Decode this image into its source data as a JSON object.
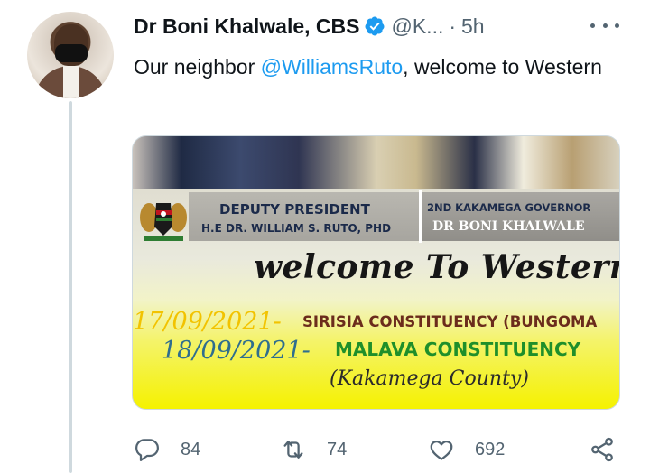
{
  "author": {
    "name": "Dr Boni Khalwale, CBS",
    "handle": "@K...",
    "separator": "·",
    "time": "5h"
  },
  "tweet": {
    "text_before": "Our neighbor ",
    "mention": "@WilliamsRuto",
    "text_after": ", welcome to Western"
  },
  "poster": {
    "deputy_title": "DEPUTY PRESIDENT",
    "deputy_name": "H.E DR. WILLIAM S. RUTO, PHD",
    "governor_title": "2ND KAKAMEGA GOVERNOR",
    "governor_name": "DR BONI KHALWALE",
    "welcome": "welcome To Western",
    "line1_date": "17/09/2021-",
    "line1_text": "SIRISIA CONSTITUENCY (BUNGOMA",
    "line2_date": "18/09/2021-",
    "line2_text": "MALAVA CONSTITUENCY",
    "county": "(Kakamega County)"
  },
  "actions": {
    "replies": "84",
    "retweets": "74",
    "likes": "692"
  },
  "colors": {
    "accent": "#1d9bf0",
    "secondary_text": "#536471",
    "thread_line": "#cfd9de"
  },
  "icons": [
    "verified-badge-icon",
    "more-options-icon",
    "reply-icon",
    "retweet-icon",
    "like-icon",
    "share-icon"
  ]
}
